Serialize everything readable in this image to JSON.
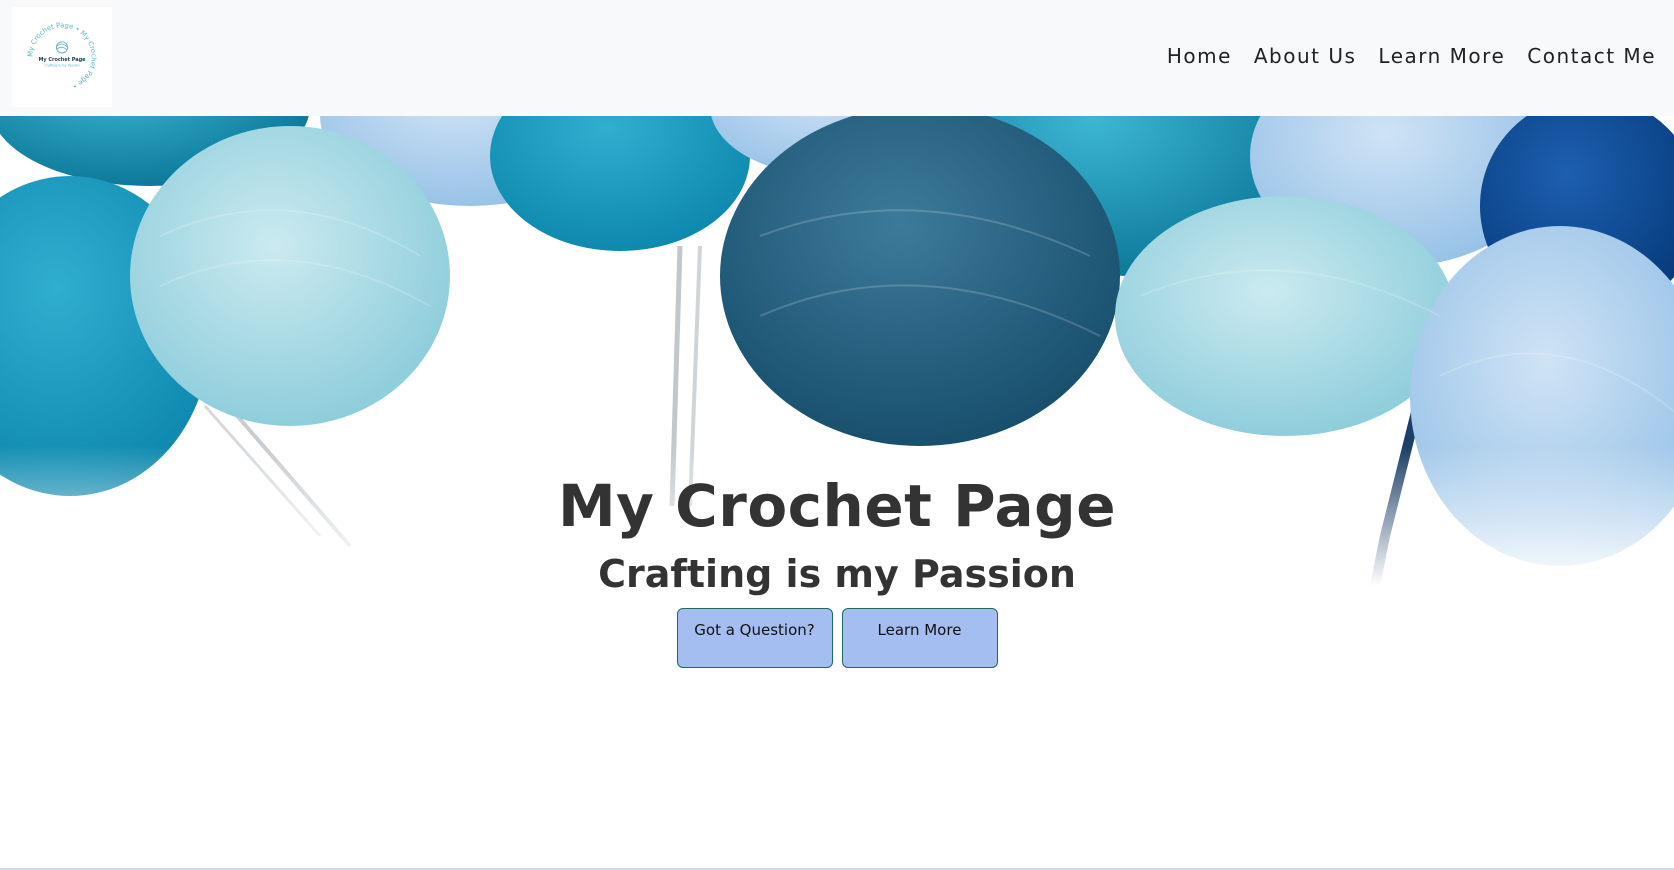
{
  "brand": {
    "logo_ring_text": "My Crochet Page • My Crochet Page •",
    "logo_center_title": "My Crochet Page",
    "logo_center_tagline": "Crafting is my Passion",
    "logo_icon": "yarn-ball-icon"
  },
  "nav": {
    "items": [
      {
        "label": "Home"
      },
      {
        "label": "About Us"
      },
      {
        "label": "Learn More"
      },
      {
        "label": "Contact Me"
      }
    ]
  },
  "hero": {
    "title": "My Crochet Page",
    "subtitle": "Crafting is my Passion",
    "buttons": [
      {
        "label": "Got a Question?"
      },
      {
        "label": "Learn More"
      }
    ]
  },
  "colors": {
    "nav_bg": "#f8f9fa",
    "button_bg": "#a4bef2",
    "button_border": "#1d6b5e",
    "heading": "#333333"
  }
}
